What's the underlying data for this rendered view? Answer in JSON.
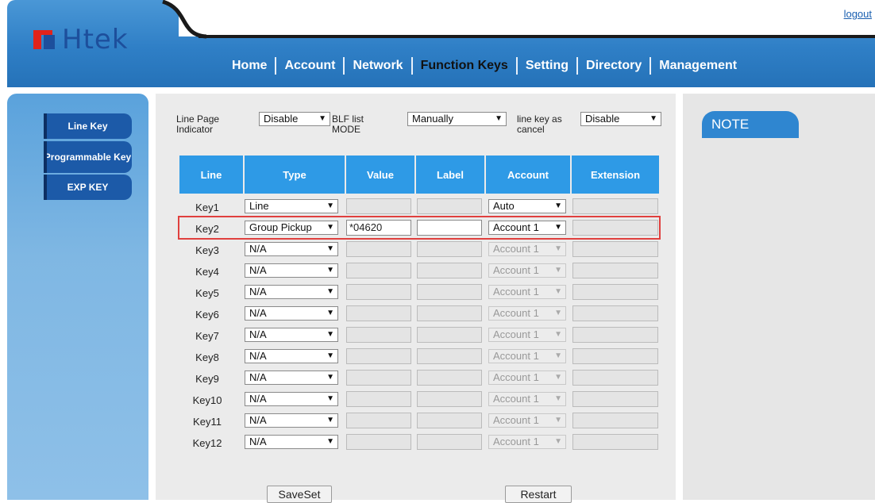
{
  "header": {
    "logo_text": "Htek",
    "logout": "logout",
    "nav": [
      "Home",
      "Account",
      "Network",
      "Function Keys",
      "Setting",
      "Directory",
      "Management"
    ],
    "active_nav": "Function Keys"
  },
  "sidebar": {
    "items": [
      {
        "label": "Line Key"
      },
      {
        "label": "Programmable Key"
      },
      {
        "label": "EXP KEY"
      }
    ]
  },
  "options": {
    "line_page_indicator": {
      "label": "Line Page Indicator",
      "value": "Disable"
    },
    "blf_list_mode": {
      "label": "BLF list MODE",
      "value": "Manually"
    },
    "line_key_as_cancel": {
      "label": "line key as cancel",
      "value": "Disable"
    }
  },
  "table": {
    "columns": [
      "Line",
      "Type",
      "Value",
      "Label",
      "Account",
      "Extension"
    ],
    "rows": [
      {
        "line": "Key1",
        "type": "Line",
        "value": "",
        "label": "",
        "account": "Auto",
        "extension": ""
      },
      {
        "line": "Key2",
        "type": "Group Pickup",
        "value": "*04620",
        "label": "",
        "account": "Account 1",
        "extension": ""
      },
      {
        "line": "Key3",
        "type": "N/A",
        "value": "",
        "label": "",
        "account": "Account 1",
        "extension": ""
      },
      {
        "line": "Key4",
        "type": "N/A",
        "value": "",
        "label": "",
        "account": "Account 1",
        "extension": ""
      },
      {
        "line": "Key5",
        "type": "N/A",
        "value": "",
        "label": "",
        "account": "Account 1",
        "extension": ""
      },
      {
        "line": "Key6",
        "type": "N/A",
        "value": "",
        "label": "",
        "account": "Account 1",
        "extension": ""
      },
      {
        "line": "Key7",
        "type": "N/A",
        "value": "",
        "label": "",
        "account": "Account 1",
        "extension": ""
      },
      {
        "line": "Key8",
        "type": "N/A",
        "value": "",
        "label": "",
        "account": "Account 1",
        "extension": ""
      },
      {
        "line": "Key9",
        "type": "N/A",
        "value": "",
        "label": "",
        "account": "Account 1",
        "extension": ""
      },
      {
        "line": "Key10",
        "type": "N/A",
        "value": "",
        "label": "",
        "account": "Account 1",
        "extension": ""
      },
      {
        "line": "Key11",
        "type": "N/A",
        "value": "",
        "label": "",
        "account": "Account 1",
        "extension": ""
      },
      {
        "line": "Key12",
        "type": "N/A",
        "value": "",
        "label": "",
        "account": "Account 1",
        "extension": ""
      }
    ]
  },
  "buttons": {
    "saveset": "SaveSet",
    "restart": "Restart"
  },
  "note": {
    "title": "NOTE"
  },
  "colors": {
    "header_blue": "#2f7fc6",
    "table_header": "#2e9ae6",
    "highlight_border": "#e0403e",
    "side_button": "#1c5aa8"
  }
}
